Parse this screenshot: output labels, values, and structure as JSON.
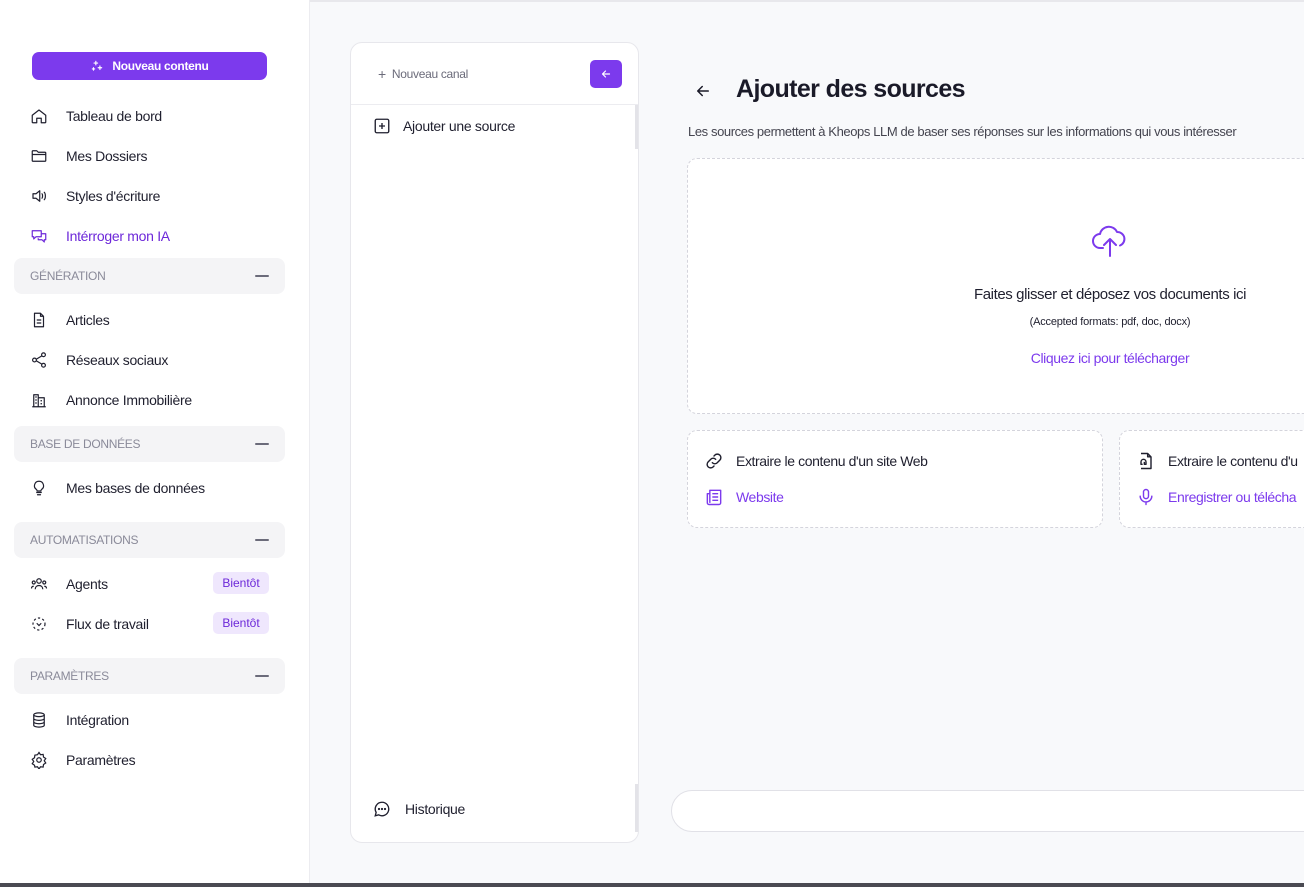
{
  "sidebar": {
    "new_content_label": "Nouveau contenu",
    "nav": {
      "dashboard": "Tableau de bord",
      "folders": "Mes Dossiers",
      "styles": "Styles d'écriture",
      "ask_ai": "Intérroger mon IA"
    },
    "sections": {
      "generation": "GÉNÉRATION",
      "database": "BASE DE DONNÉES",
      "automation": "AUTOMATISATIONS",
      "settings": "PARAMÈTRES"
    },
    "generation_items": {
      "articles": "Articles",
      "social": "Réseaux sociaux",
      "real_estate": "Annonce Immobilière"
    },
    "database_items": {
      "my_databases": "Mes bases de données"
    },
    "automation_items": {
      "agents": "Agents",
      "workflows": "Flux de travail",
      "soon_badge": "Bientôt"
    },
    "settings_items": {
      "integration": "Intégration",
      "parameters": "Paramètres"
    }
  },
  "channels": {
    "new_channel": "Nouveau canal",
    "add_source": "Ajouter une source",
    "history": "Historique"
  },
  "main": {
    "title": "Ajouter des sources",
    "subtitle": "Les sources permettent à Kheops LLM de baser ses réponses sur les informations qui vous intéresser",
    "dropzone": {
      "title": "Faites glisser et déposez vos documents ici",
      "formats": "(Accepted formats: pdf, doc, docx)",
      "link": "Cliquez ici pour télécharger"
    },
    "web_card": {
      "title": "Extraire le contenu d'un site Web",
      "link": "Website"
    },
    "audio_card": {
      "title": "Extraire le contenu d'u",
      "link": "Enregistrer ou télécha"
    }
  },
  "colors": {
    "accent": "#7c3aed",
    "accent_light": "#efe7fd"
  }
}
